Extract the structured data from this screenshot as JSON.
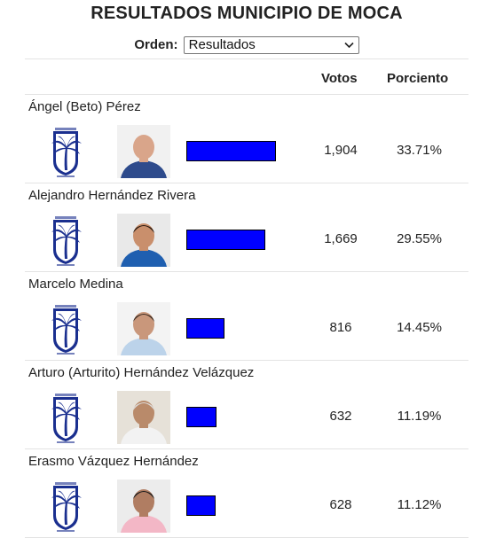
{
  "page": {
    "title": "RESULTADOS MUNICIPIO DE MOCA"
  },
  "order": {
    "label": "Orden:",
    "selected": "Resultados"
  },
  "table": {
    "headers": {
      "votes": "Votos",
      "percent": "Porciento"
    },
    "candidates": [
      {
        "name": "Ángel (Beto) Pérez",
        "votes": "1,904",
        "percent": "33.71%",
        "share": 0.3371
      },
      {
        "name": "Alejandro Hernández Rivera",
        "votes": "1,669",
        "percent": "29.55%",
        "share": 0.2955
      },
      {
        "name": "Marcelo Medina",
        "votes": "816",
        "percent": "14.45%",
        "share": 0.1445
      },
      {
        "name": "Arturo (Arturito) Hernández Velázquez",
        "votes": "632",
        "percent": "11.19%",
        "share": 0.1119
      },
      {
        "name": "Erasmo Vázquez Hernández",
        "votes": "628",
        "percent": "11.12%",
        "share": 0.1112
      }
    ]
  },
  "colors": {
    "bar": "#0000ff",
    "party_logo": "#1a2f8f",
    "text": "#222222",
    "divider": "#e3e3e3"
  },
  "icons": {
    "party_logo": "palm-tree-party-logo",
    "select_arrow": "chevron-down-icon"
  }
}
